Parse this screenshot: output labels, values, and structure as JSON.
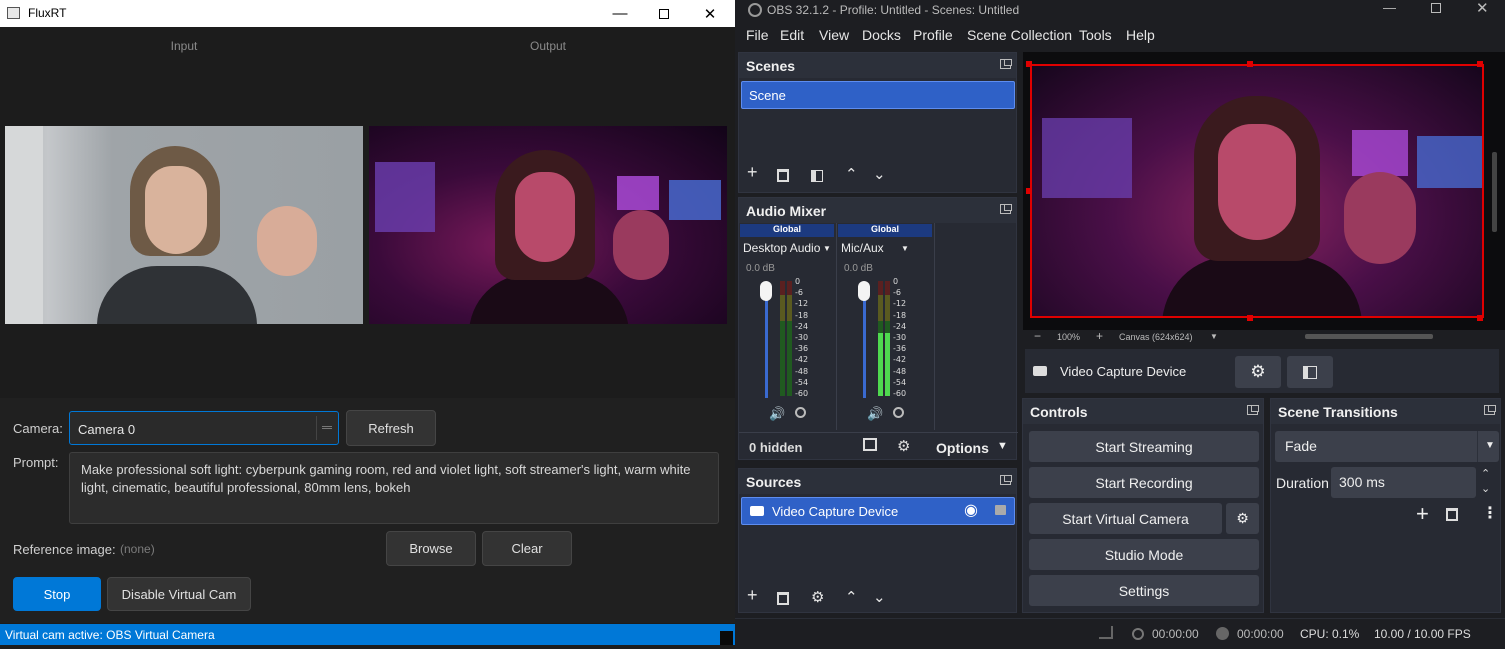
{
  "flux": {
    "title": "FluxRT",
    "input_label": "Input",
    "output_label": "Output",
    "camera_label": "Camera:",
    "camera_value": "Camera 0",
    "refresh": "Refresh",
    "prompt_label": "Prompt:",
    "prompt_text": "Make professional soft light: cyberpunk gaming room, red and violet light, soft streamer's light, warm white light, cinematic, beautiful professional, 80mm lens, bokeh",
    "ref_label": "Reference image:",
    "ref_value": "(none)",
    "browse": "Browse",
    "clear": "Clear",
    "stop": "Stop",
    "disable_vcam": "Disable Virtual Cam",
    "status": "Virtual cam active: OBS Virtual Camera",
    "accent": "#0078d7"
  },
  "obs": {
    "title": "OBS 32.1.2 - Profile: Untitled - Scenes: Untitled",
    "menu": [
      "File",
      "Edit",
      "View",
      "Docks",
      "Profile",
      "Scene Collection",
      "Tools",
      "Help"
    ],
    "scenes": {
      "title": "Scenes",
      "items": [
        "Scene"
      ]
    },
    "mixer": {
      "title": "Audio Mixer",
      "channels": [
        {
          "badge": "Global",
          "name": "Desktop Audio",
          "db": "0.0 dB",
          "level": 0
        },
        {
          "badge": "Global",
          "name": "Mic/Aux",
          "db": "0.0 dB",
          "level": 0.55
        }
      ],
      "ticks": [
        "0",
        "-6",
        "-12",
        "-18",
        "-24",
        "-30",
        "-36",
        "-42",
        "-48",
        "-54",
        "-60"
      ],
      "hidden": "0 hidden",
      "options": "Options"
    },
    "sources": {
      "title": "Sources",
      "items": [
        "Video Capture Device"
      ]
    },
    "preview": {
      "zoom": "100%",
      "canvas": "Canvas (624x624)",
      "minus": "−",
      "plus": "+"
    },
    "source_bar": {
      "name": "Video Capture Device"
    },
    "controls": {
      "title": "Controls",
      "buttons": [
        "Start Streaming",
        "Start Recording",
        "Start Virtual Camera",
        "Studio Mode",
        "Settings"
      ]
    },
    "transitions": {
      "title": "Scene Transitions",
      "selected": "Fade",
      "duration_label": "Duration",
      "duration_value": "300 ms"
    },
    "status": {
      "rec_time": "00:00:00",
      "stream_time": "00:00:00",
      "cpu": "CPU: 0.1%",
      "fps": "10.00 / 10.00 FPS"
    },
    "accent": "#2f61c7"
  }
}
